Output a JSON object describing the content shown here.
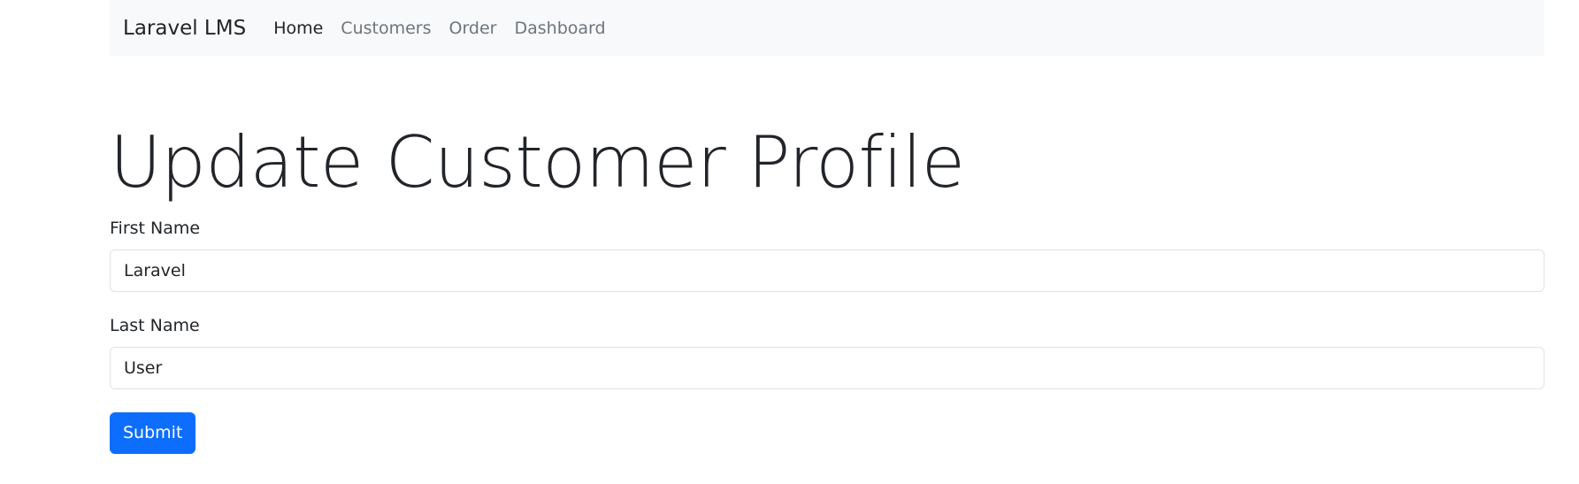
{
  "navbar": {
    "brand": "Laravel LMS",
    "links": [
      {
        "label": "Home",
        "active": true
      },
      {
        "label": "Customers",
        "active": false
      },
      {
        "label": "Order",
        "active": false
      },
      {
        "label": "Dashboard",
        "active": false
      }
    ]
  },
  "page": {
    "title": "Update Customer Profile"
  },
  "form": {
    "first_name": {
      "label": "First Name",
      "value": "Laravel"
    },
    "last_name": {
      "label": "Last Name",
      "value": "User"
    },
    "submit_label": "Submit"
  },
  "colors": {
    "navbar_bg": "#f8f9fa",
    "primary": "#0d6efd",
    "text": "#212529",
    "muted": "#6c757d"
  }
}
